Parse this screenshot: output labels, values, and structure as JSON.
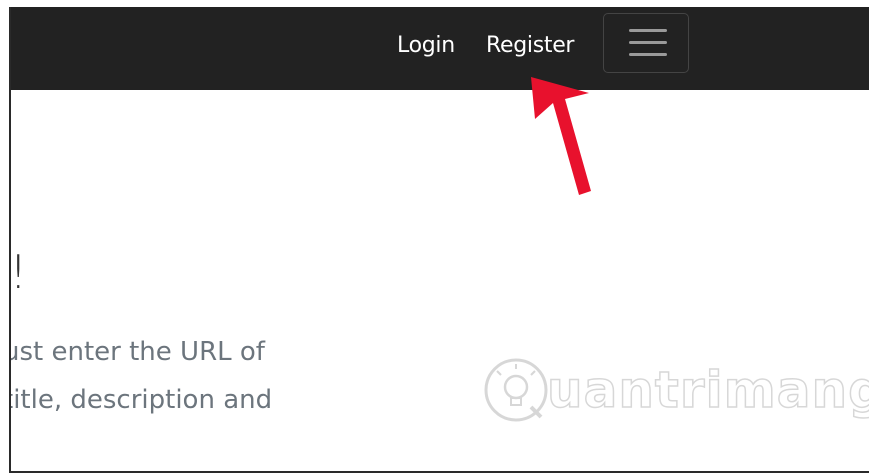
{
  "navbar": {
    "login_label": "Login",
    "register_label": "Register",
    "toggler_icon": "hamburger-menu-icon",
    "background": "#222222"
  },
  "main": {
    "heading_fragment": "!",
    "lead_line_1": "ust enter the URL of",
    "lead_line_2": "title, description and"
  },
  "annotation": {
    "arrow_color": "#e8112d",
    "arrow_icon": "red-arrow-pointer"
  },
  "watermark": {
    "text": "uantrimang",
    "icon": "quantrimang-bulb-logo"
  }
}
